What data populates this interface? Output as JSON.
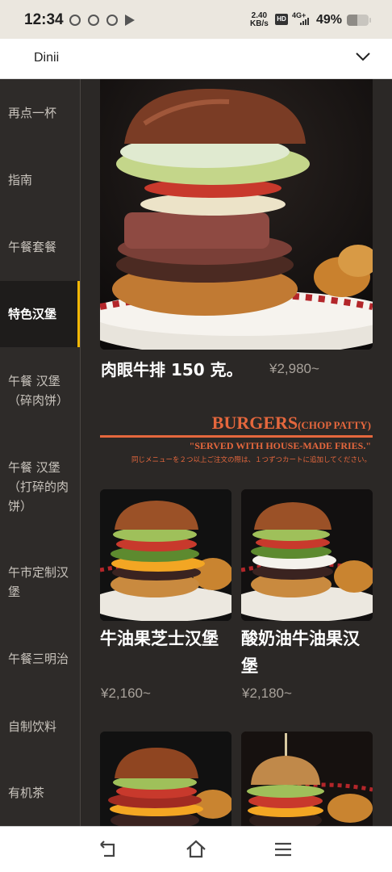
{
  "status_bar": {
    "time": "12:34",
    "net_speed_value": "2.40",
    "net_speed_unit": "KB/s",
    "hd": "HD",
    "signal": "4G+",
    "battery": "49%",
    "battery_level": 0.49
  },
  "header": {
    "title": "Dinii",
    "dropdown_icon": "chevron-down-icon"
  },
  "sidebar": {
    "items": [
      {
        "label": "再点一杯"
      },
      {
        "label": "指南"
      },
      {
        "label": "午餐套餐"
      },
      {
        "label": "特色汉堡",
        "active": true
      },
      {
        "label": "午餐 汉堡（碎肉饼）"
      },
      {
        "label": "午餐 汉堡（打碎的肉饼）"
      },
      {
        "label": "午市定制汉堡"
      },
      {
        "label": "午餐三明治"
      },
      {
        "label": "自制饮料"
      },
      {
        "label": "有机茶"
      }
    ],
    "active_color": "#f2b705"
  },
  "featured": {
    "name": "肉眼牛排 150 克。",
    "price": "¥2,980~"
  },
  "banner": {
    "title": "BURGERS",
    "title_suffix": "(CHOP PATTY)",
    "subtitle": "\"SERVED WITH HOUSE-MADE FRIES.\"",
    "note": "同じメニューを２つ以上ご注文の際は、１つずつカートに追加してください。",
    "accent_color": "#e5673d"
  },
  "menu_items": [
    {
      "name": "牛油果芝士汉堡",
      "price": "¥2,160~"
    },
    {
      "name": "酸奶油牛油果汉堡",
      "price": "¥2,180~"
    }
  ],
  "nav_bar": {
    "back_icon": "back-icon",
    "home_icon": "home-icon",
    "menu_icon": "menu-icon"
  }
}
